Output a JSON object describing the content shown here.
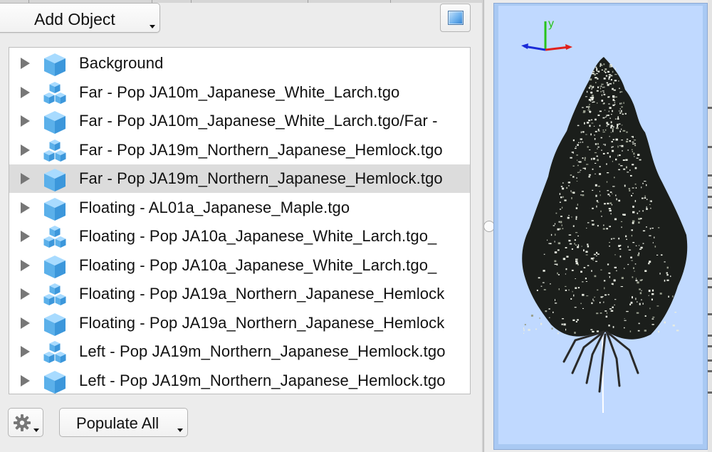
{
  "toolbar": {
    "add_object_label": "Add Object",
    "view_button_icon": "viewport-toggle-icon",
    "gear_icon": "gear-icon",
    "populate_label": "Populate All"
  },
  "object_list": {
    "items": [
      {
        "label": "Background",
        "icon": "cube-icon",
        "selected": false
      },
      {
        "label": "Far - Pop JA10m_Japanese_White_Larch.tgo",
        "icon": "cube-cluster-icon",
        "selected": false
      },
      {
        "label": "Far - Pop JA10m_Japanese_White_Larch.tgo/Far -",
        "icon": "cube-icon",
        "selected": false
      },
      {
        "label": "Far - Pop JA19m_Northern_Japanese_Hemlock.tgo",
        "icon": "cube-cluster-icon",
        "selected": false
      },
      {
        "label": "Far - Pop JA19m_Northern_Japanese_Hemlock.tgo",
        "icon": "cube-icon",
        "selected": true
      },
      {
        "label": "Floating - AL01a_Japanese_Maple.tgo",
        "icon": "cube-icon",
        "selected": false
      },
      {
        "label": "Floating - Pop JA10a_Japanese_White_Larch.tgo_",
        "icon": "cube-cluster-icon",
        "selected": false
      },
      {
        "label": "Floating - Pop JA10a_Japanese_White_Larch.tgo_",
        "icon": "cube-icon",
        "selected": false
      },
      {
        "label": "Floating - Pop JA19a_Northern_Japanese_Hemlock",
        "icon": "cube-cluster-icon",
        "selected": false
      },
      {
        "label": "Floating - Pop JA19a_Northern_Japanese_Hemlock",
        "icon": "cube-icon",
        "selected": false
      },
      {
        "label": "Left - Pop JA19m_Northern_Japanese_Hemlock.tgo",
        "icon": "cube-cluster-icon",
        "selected": false
      },
      {
        "label": "Left - Pop JA19m_Northern_Japanese_Hemlock.tgo",
        "icon": "cube-icon",
        "selected": false
      }
    ]
  },
  "preview": {
    "axis_label_y": "y",
    "background_color": "#c0d9ff",
    "axis_colors": {
      "x": "#e0201c",
      "y": "#27c41a",
      "z": "#1a2bd8"
    },
    "subject_icon": "conifer-tree-preview"
  },
  "colors": {
    "selected_row": "#dcdcdc",
    "icon_blue": "#59aee9"
  }
}
